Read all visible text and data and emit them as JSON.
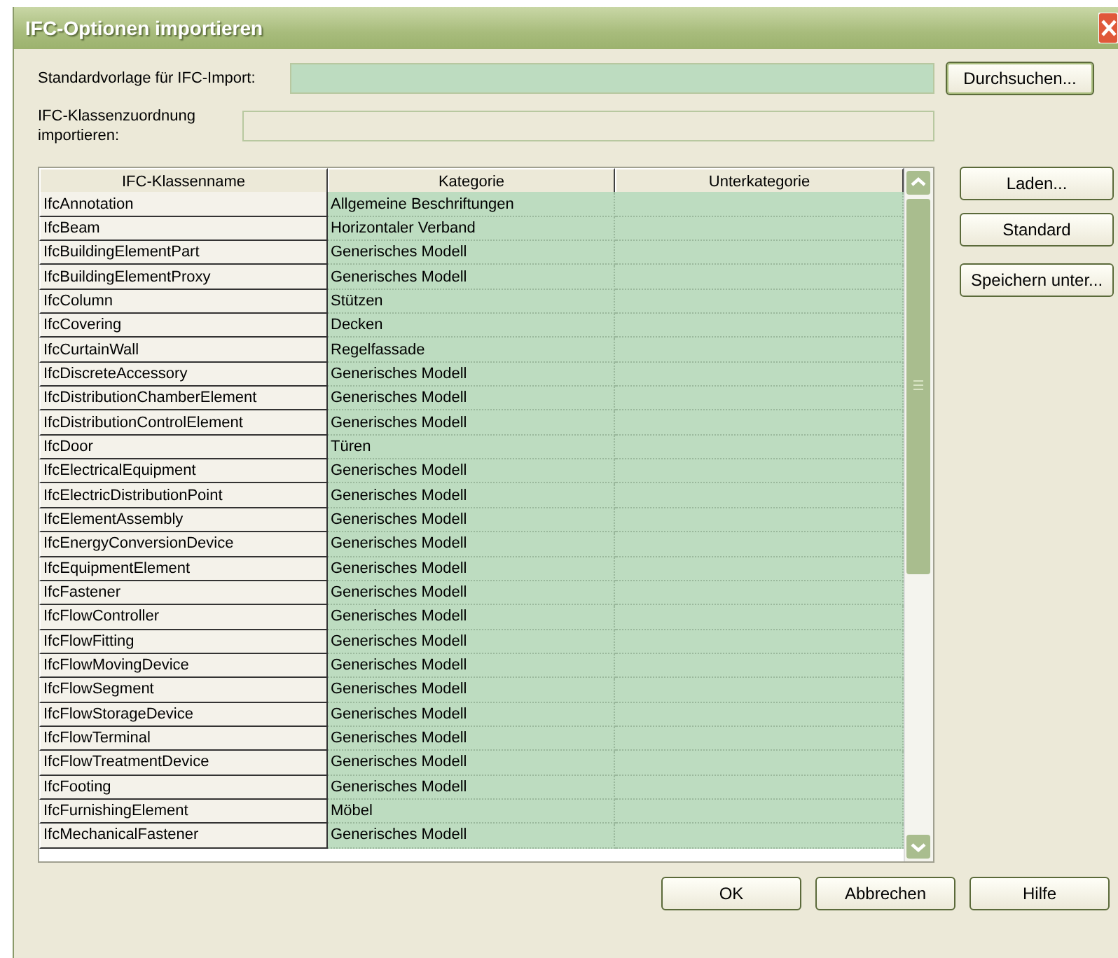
{
  "window": {
    "title": "IFC-Optionen importieren"
  },
  "fields": [
    {
      "label": "Standardvorlage für IFC-Import:",
      "kind": "green"
    },
    {
      "label": "IFC-Klassenzuordnung importieren:",
      "kind": "plain"
    }
  ],
  "browse_button": "Durchsuchen...",
  "table": {
    "columns": [
      "IFC-Klassenname",
      "Kategorie",
      "Unterkategorie"
    ],
    "rows": [
      {
        "name": "IfcAnnotation",
        "category": "Allgemeine Beschriftungen"
      },
      {
        "name": "IfcBeam",
        "category": "Horizontaler Verband"
      },
      {
        "name": "IfcBuildingElementPart",
        "category": "Generisches Modell"
      },
      {
        "name": "IfcBuildingElementProxy",
        "category": "Generisches Modell"
      },
      {
        "name": "IfcColumn",
        "category": "Stützen"
      },
      {
        "name": "IfcCovering",
        "category": "Decken"
      },
      {
        "name": "IfcCurtainWall",
        "category": "Regelfassade"
      },
      {
        "name": "IfcDiscreteAccessory",
        "category": "Generisches Modell"
      },
      {
        "name": "IfcDistributionChamberElement",
        "category": "Generisches Modell"
      },
      {
        "name": "IfcDistributionControlElement",
        "category": "Generisches Modell"
      },
      {
        "name": "IfcDoor",
        "category": "Türen"
      },
      {
        "name": "IfcElectricalEquipment",
        "category": "Generisches Modell"
      },
      {
        "name": "IfcElectricDistributionPoint",
        "category": "Generisches Modell"
      },
      {
        "name": "IfcElementAssembly",
        "category": "Generisches Modell"
      },
      {
        "name": "IfcEnergyConversionDevice",
        "category": "Generisches Modell"
      },
      {
        "name": "IfcEquipmentElement",
        "category": "Generisches Modell"
      },
      {
        "name": "IfcFastener",
        "category": "Generisches Modell"
      },
      {
        "name": "IfcFlowController",
        "category": "Generisches Modell"
      },
      {
        "name": "IfcFlowFitting",
        "category": "Generisches Modell"
      },
      {
        "name": "IfcFlowMovingDevice",
        "category": "Generisches Modell"
      },
      {
        "name": "IfcFlowSegment",
        "category": "Generisches Modell"
      },
      {
        "name": "IfcFlowStorageDevice",
        "category": "Generisches Modell"
      },
      {
        "name": "IfcFlowTerminal",
        "category": "Generisches Modell"
      },
      {
        "name": "IfcFlowTreatmentDevice",
        "category": "Generisches Modell"
      },
      {
        "name": "IfcFooting",
        "category": "Generisches Modell"
      },
      {
        "name": "IfcFurnishingElement",
        "category": "Möbel"
      },
      {
        "name": "IfcMechanicalFastener",
        "category": "Generisches Modell"
      }
    ]
  },
  "side_buttons": [
    "Laden...",
    "Standard",
    "Speichern unter..."
  ],
  "footer_buttons": [
    "OK",
    "Abbrechen",
    "Hilfe"
  ]
}
